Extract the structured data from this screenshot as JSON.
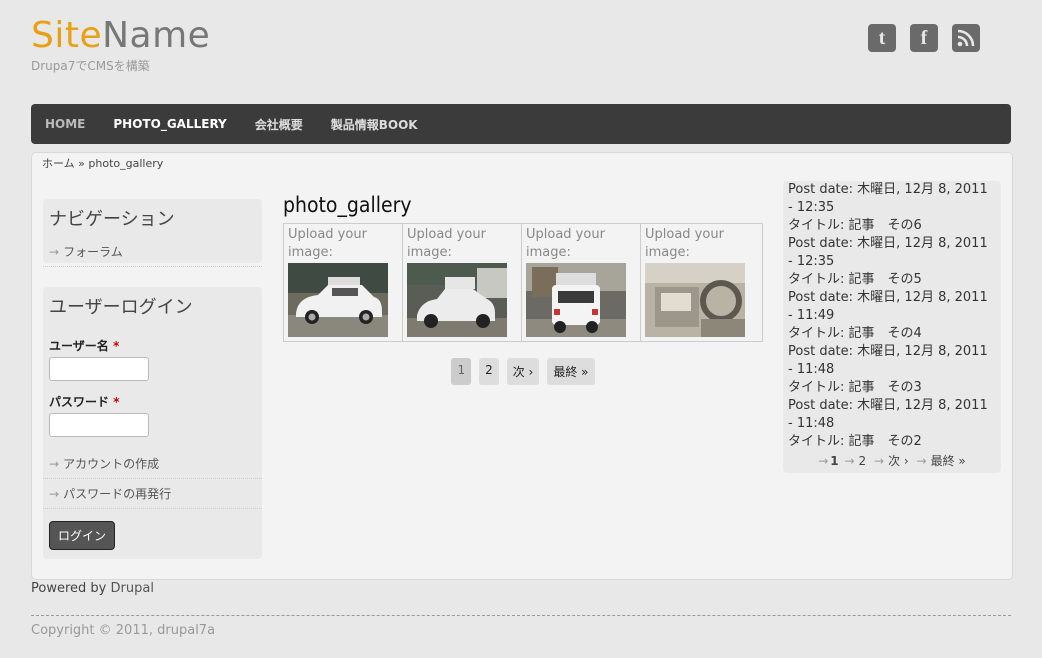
{
  "site": {
    "name_part1": "Site",
    "name_part2": "Name",
    "slogan": "Drupa7でCMSを構築"
  },
  "social": [
    {
      "icon": "twitter-icon",
      "glyph": "t"
    },
    {
      "icon": "facebook-icon",
      "glyph": "f"
    },
    {
      "icon": "rss-icon",
      "glyph": "≋"
    }
  ],
  "nav": {
    "items": [
      "HOME",
      "PHOTO_GALLERY",
      "会社概要",
      "製品情報BOOK"
    ]
  },
  "breadcrumb": {
    "home": "ホーム",
    "sep": "»",
    "current": "photo_gallery"
  },
  "navigation_block": {
    "title": "ナビゲーション",
    "links": [
      "フォーラム"
    ]
  },
  "login_block": {
    "title": "ユーザーログイン",
    "username_label": "ユーザー名",
    "password_label": "パスワード",
    "required_mark": "*",
    "links": [
      "アカウントの作成",
      "パスワードの再発行"
    ],
    "login_button": "ログイン"
  },
  "content": {
    "title": "photo_gallery",
    "gallery": [
      {
        "label": "Upload your image:",
        "image": "car-photo-1"
      },
      {
        "label": "Upload your image:",
        "image": "car-photo-2"
      },
      {
        "label": "Upload your image:",
        "image": "car-photo-3"
      },
      {
        "label": "Upload your image:",
        "image": "car-interior-photo"
      }
    ],
    "pager": [
      "1",
      "2",
      "次 ›",
      "最終 »"
    ]
  },
  "recent_posts": {
    "items": [
      {
        "date": "Post date: 木曜日, 12月 8, 2011 - 12:35",
        "title": "タイトル: 記事　その6"
      },
      {
        "date": "Post date: 木曜日, 12月 8, 2011 - 12:35",
        "title": "タイトル: 記事　その5"
      },
      {
        "date": "Post date: 木曜日, 12月 8, 2011 - 11:49",
        "title": "タイトル: 記事　その4"
      },
      {
        "date": "Post date: 木曜日, 12月 8, 2011 - 11:48",
        "title": "タイトル: 記事　その3"
      },
      {
        "date": "Post date: 木曜日, 12月 8, 2011 - 11:48",
        "title": "タイトル: 記事　その2"
      }
    ],
    "pager": [
      "1",
      "2",
      "次 ›",
      "最終 »"
    ]
  },
  "footer": {
    "powered_prefix": "Powered by",
    "powered_link": "Drupal",
    "copyright": "Copyright © 2011, drupal7a"
  },
  "colors": {
    "accent": "#e8a015",
    "nav_bg": "#3b3b3b",
    "page_bg": "#e8e8e8"
  }
}
